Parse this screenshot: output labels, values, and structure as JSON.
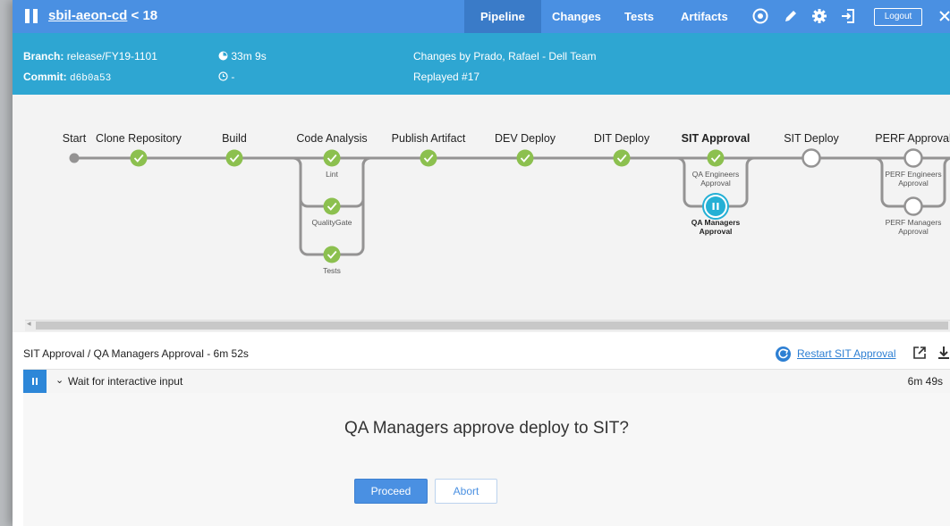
{
  "header": {
    "pipeline_name": "sbil-aeon-cd",
    "run_number": "18",
    "nav": [
      "Pipeline",
      "Changes",
      "Tests",
      "Artifacts"
    ],
    "logout_label": "Logout"
  },
  "run": {
    "branch_label": "Branch:",
    "branch": "release/FY19-1101",
    "commit_label": "Commit:",
    "commit": "d6b0a53",
    "duration": "33m 9s",
    "ended": "-",
    "changes": "Changes by Prado, Rafael - Dell Team",
    "replayed": "Replayed #17"
  },
  "stages": [
    {
      "label": "Start",
      "status": "start"
    },
    {
      "label": "Clone Repository",
      "status": "success"
    },
    {
      "label": "Build",
      "status": "success"
    },
    {
      "label": "Code Analysis",
      "status": "success",
      "parallel": [
        {
          "label": "Lint",
          "status": "success"
        },
        {
          "label": "QualityGate",
          "status": "success"
        },
        {
          "label": "Tests",
          "status": "success"
        }
      ]
    },
    {
      "label": "Publish Artifact",
      "status": "success"
    },
    {
      "label": "DEV Deploy",
      "status": "success"
    },
    {
      "label": "DIT Deploy",
      "status": "success"
    },
    {
      "label": "SIT Approval",
      "status": "paused",
      "selected": true,
      "parallel": [
        {
          "label": "QA Engineers Approval",
          "status": "success"
        },
        {
          "label": "QA Managers Approval",
          "status": "paused",
          "selected": true
        }
      ]
    },
    {
      "label": "SIT Deploy",
      "status": "not-built"
    },
    {
      "label": "PERF Approval",
      "status": "not-built",
      "parallel": [
        {
          "label": "PERF Engineers Approval",
          "status": "not-built"
        },
        {
          "label": "PERF Managers Approval",
          "status": "not-built"
        }
      ]
    }
  ],
  "step": {
    "title": "SIT Approval / QA Managers Approval - 6m 52s",
    "restart_label": "Restart SIT Approval",
    "wait_label": "Wait for interactive input",
    "wait_duration": "6m 49s",
    "question": "QA Managers approve deploy to SIT?",
    "proceed_label": "Proceed",
    "abort_label": "Abort"
  },
  "colors": {
    "topbar": "#4a90e2",
    "infobar": "#2ea6d2",
    "success": "#8cc04f",
    "paused": "#24b0d5",
    "connector": "#949393"
  }
}
